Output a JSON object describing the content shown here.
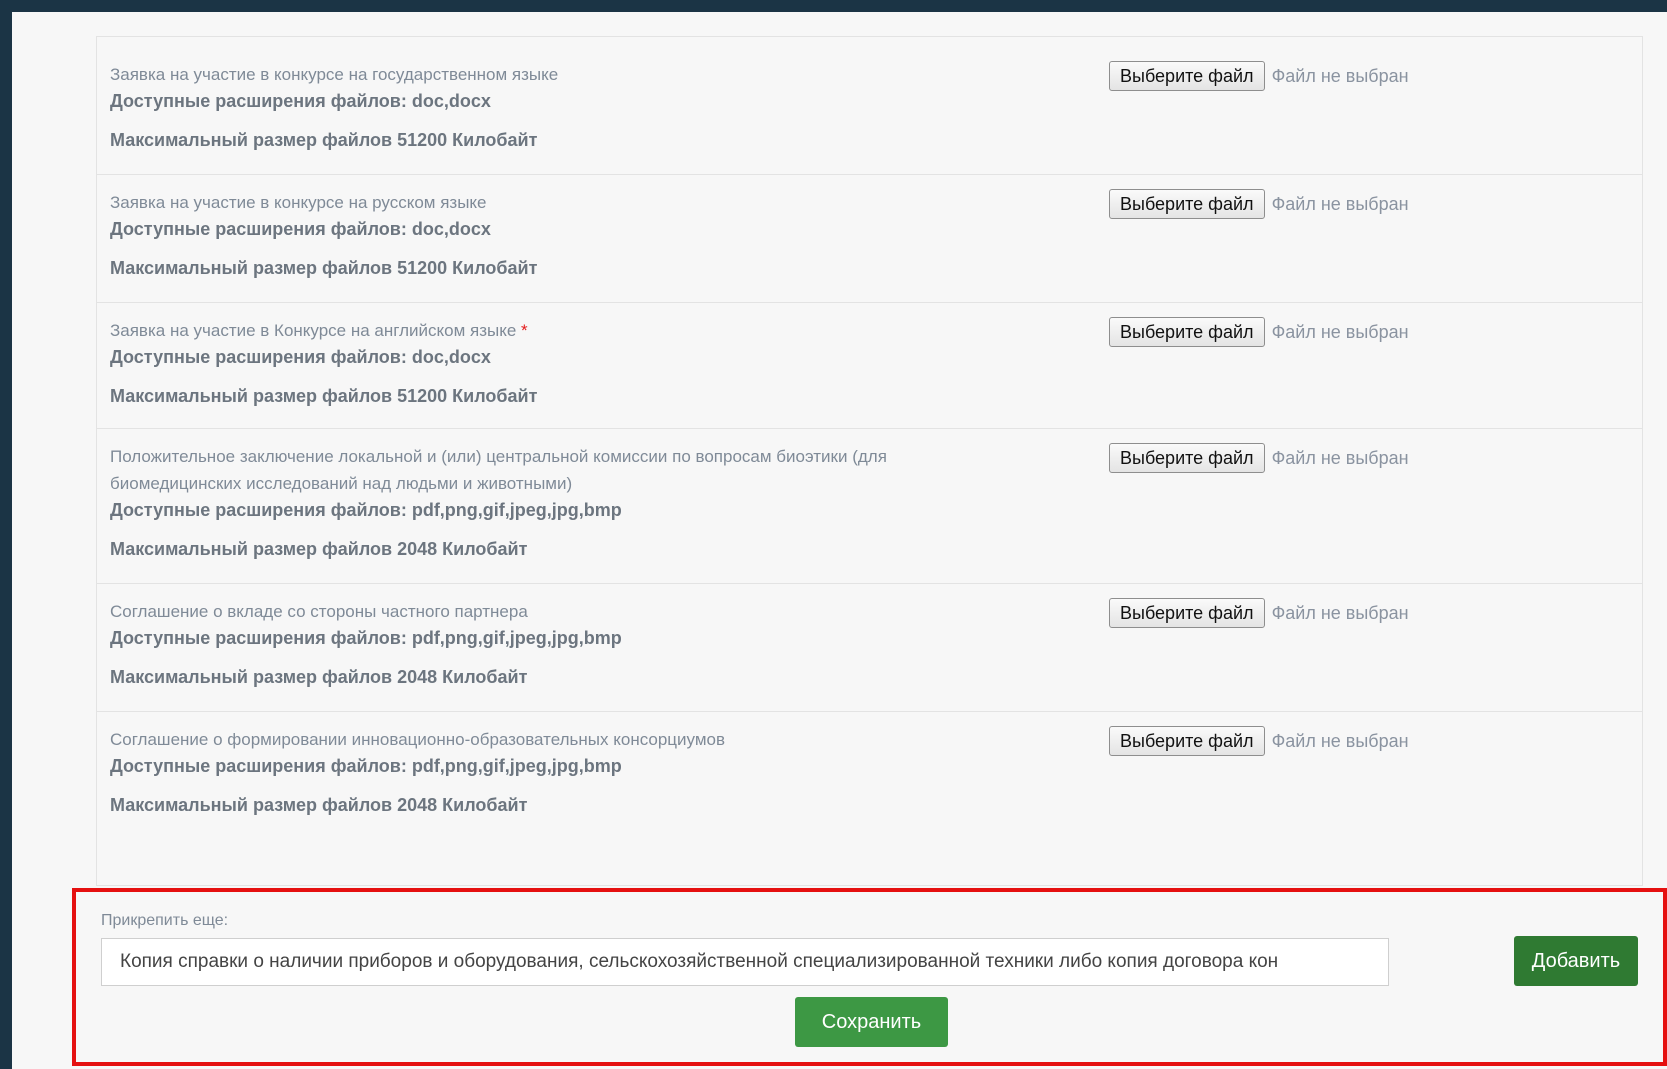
{
  "file_button_label": "Выберите файл",
  "file_status": "Файл не выбран",
  "items": [
    {
      "label": "Заявка на участие в конкурсе на государственном языке",
      "required": "",
      "ext": "Доступные расширения файлов: doc,docx",
      "max": "Максимальный размер файлов 51200 Килобайт"
    },
    {
      "label": "Заявка на участие в конкурсе на русском языке",
      "required": "",
      "ext": "Доступные расширения файлов: doc,docx",
      "max": "Максимальный размер файлов 51200 Килобайт"
    },
    {
      "label": "Заявка на участие в Конкурсе на английском языке",
      "required": "*",
      "ext": "Доступные расширения файлов: doc,docx",
      "max": "Максимальный размер файлов 51200 Килобайт"
    },
    {
      "label": "Положительное заключение локальной и (или) центральной комиссии по вопросам биоэтики (для биомедицинских исследований над людьми и животными)",
      "required": "",
      "ext": "Доступные расширения файлов: pdf,png,gif,jpeg,jpg,bmp",
      "max": "Максимальный размер файлов 2048 Килобайт"
    },
    {
      "label": "Соглашение о вкладе со стороны частного партнера",
      "required": "",
      "ext": "Доступные расширения файлов: pdf,png,gif,jpeg,jpg,bmp",
      "max": "Максимальный размер файлов 2048 Килобайт"
    },
    {
      "label": "Соглашение о формировании инновационно-образовательных консорциумов",
      "required": "",
      "ext": "Доступные расширения файлов: pdf,png,gif,jpeg,jpg,bmp",
      "max": "Максимальный размер файлов 2048 Килобайт"
    }
  ],
  "attach": {
    "label": "Прикрепить еще:",
    "selected": "Копия справки о наличии приборов и оборудования, сельскохозяйственной специализированной техники либо копия договора кон",
    "add_label": "Добавить",
    "save_label": "Сохранить"
  }
}
